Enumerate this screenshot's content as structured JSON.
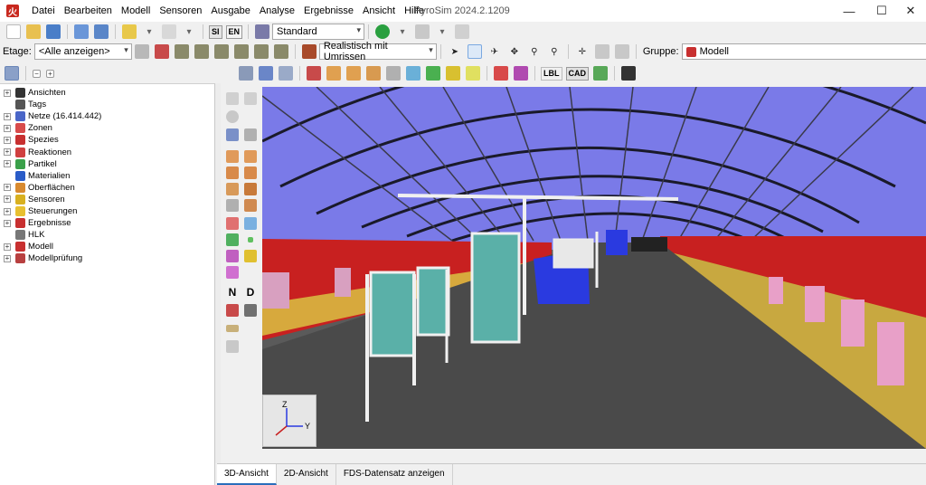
{
  "app": {
    "logo_text": "火",
    "window_title": "PyroSim 2024.2.1209",
    "window_controls": {
      "minimize": "—",
      "maximize": "☐",
      "close": "✕"
    }
  },
  "menu": [
    "Datei",
    "Bearbeiten",
    "Modell",
    "Sensoren",
    "Ausgabe",
    "Analyse",
    "Ergebnisse",
    "Ansicht",
    "Hilfe"
  ],
  "toolbar1": {
    "si_label": "SI",
    "en_label": "EN",
    "view_combo": "Standard"
  },
  "toolbar2": {
    "floor_label": "Etage:",
    "floor_combo": "<Alle anzeigen>",
    "render_combo": "Realistisch mit Umrissen",
    "group_label": "Gruppe:",
    "group_combo": "Modell"
  },
  "toolbar3": {
    "lbl_label": "LBL",
    "cad_label": "CAD"
  },
  "tree": [
    {
      "label": "Ansichten",
      "expandable": true,
      "icon": "views-icon",
      "color": "#333333"
    },
    {
      "label": "Tags",
      "expandable": false,
      "icon": "tag-icon",
      "color": "#555555"
    },
    {
      "label": "Netze (16.414.442)",
      "expandable": true,
      "icon": "mesh-icon",
      "color": "#4a66c8"
    },
    {
      "label": "Zonen",
      "expandable": true,
      "icon": "zone-icon",
      "color": "#d84b4b"
    },
    {
      "label": "Spezies",
      "expandable": true,
      "icon": "species-icon",
      "color": "#c83030"
    },
    {
      "label": "Reaktionen",
      "expandable": true,
      "icon": "reaction-icon",
      "color": "#d04040"
    },
    {
      "label": "Partikel",
      "expandable": true,
      "icon": "particle-icon",
      "color": "#3aa04a"
    },
    {
      "label": "Materialien",
      "expandable": false,
      "icon": "material-icon",
      "color": "#2a5cc8"
    },
    {
      "label": "Oberflächen",
      "expandable": true,
      "icon": "surface-icon",
      "color": "#d88a30"
    },
    {
      "label": "Sensoren",
      "expandable": true,
      "icon": "sensor-icon",
      "color": "#d8b020"
    },
    {
      "label": "Steuerungen",
      "expandable": true,
      "icon": "control-icon",
      "color": "#e8c030"
    },
    {
      "label": "Ergebnisse",
      "expandable": true,
      "icon": "results-icon",
      "color": "#c83030"
    },
    {
      "label": "HLK",
      "expandable": false,
      "icon": "hvac-icon",
      "color": "#777777"
    },
    {
      "label": "Modell",
      "expandable": true,
      "icon": "model-icon",
      "color": "#c83030"
    },
    {
      "label": "Modellprüfung",
      "expandable": true,
      "icon": "model-check-icon",
      "color": "#b84040"
    }
  ],
  "strip_letters": {
    "n": "N",
    "d": "D"
  },
  "axis": {
    "z": "Z",
    "y": "Y"
  },
  "bottom_tabs": [
    {
      "label": "3D-Ansicht",
      "active": true
    },
    {
      "label": "2D-Ansicht",
      "active": false
    },
    {
      "label": "FDS-Datensatz anzeigen",
      "active": false
    }
  ]
}
